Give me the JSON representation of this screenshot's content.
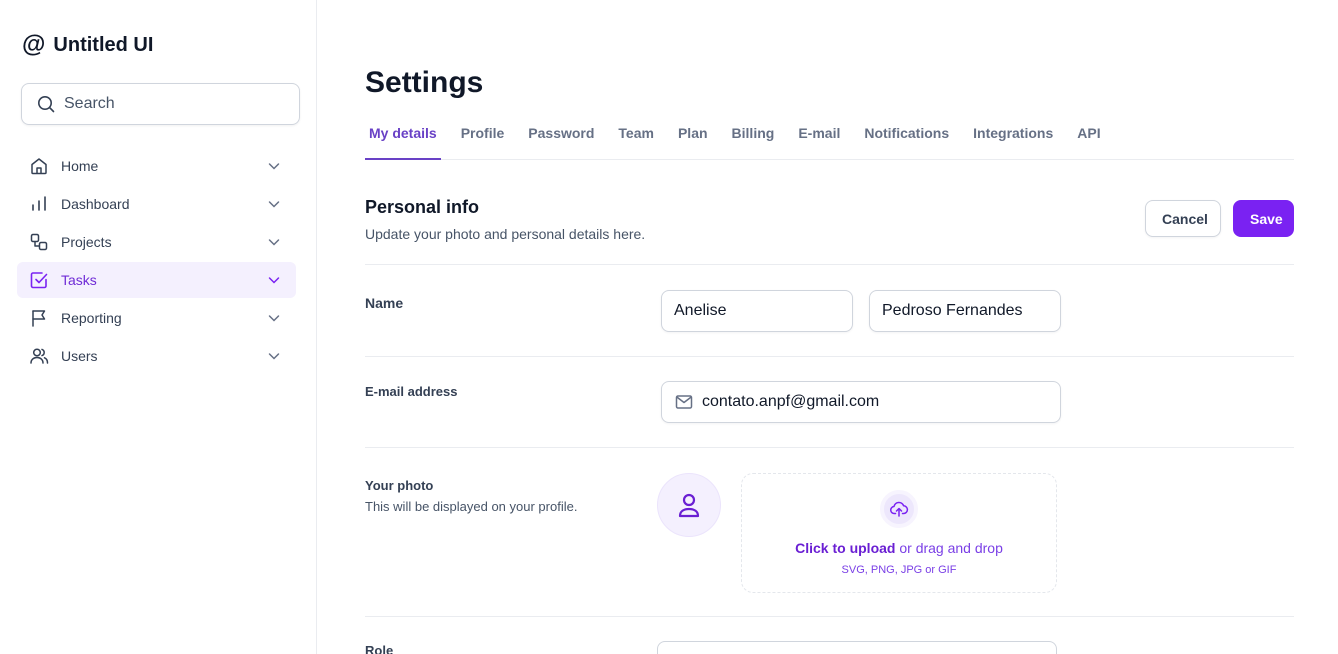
{
  "brand": {
    "icon": "@",
    "name": "Untitled UI"
  },
  "search": {
    "placeholder": "Search"
  },
  "sidebar": {
    "items": [
      {
        "label": "Home",
        "icon": "home-icon"
      },
      {
        "label": "Dashboard",
        "icon": "bar-chart-icon"
      },
      {
        "label": "Projects",
        "icon": "projects-icon"
      },
      {
        "label": "Tasks",
        "icon": "check-square-icon",
        "active": true
      },
      {
        "label": "Reporting",
        "icon": "flag-icon"
      },
      {
        "label": "Users",
        "icon": "users-icon"
      }
    ]
  },
  "page": {
    "title": "Settings"
  },
  "tabs": [
    "My details",
    "Profile",
    "Password",
    "Team",
    "Plan",
    "Billing",
    "E-mail",
    "Notifications",
    "Integrations",
    "API"
  ],
  "active_tab": "My details",
  "section": {
    "title": "Personal info",
    "subtitle": "Update your photo and personal details here.",
    "cancel_label": "Cancel",
    "save_label": "Save"
  },
  "form": {
    "name_label": "Name",
    "first_name": "Anelise",
    "last_name": "Pedroso Fernandes",
    "email_label": "E-mail address",
    "email": "contato.anpf@gmail.com",
    "photo_label": "Your photo",
    "photo_help": "This will be displayed on your profile.",
    "upload_link": "Click to upload",
    "upload_rest": " or drag and drop",
    "upload_hint": "SVG, PNG, JPG or GIF",
    "role_label": "Role"
  },
  "colors": {
    "accent": "#7a22f2",
    "active_tab": "#6941c6",
    "active_nav_bg": "#f4f0fe"
  }
}
